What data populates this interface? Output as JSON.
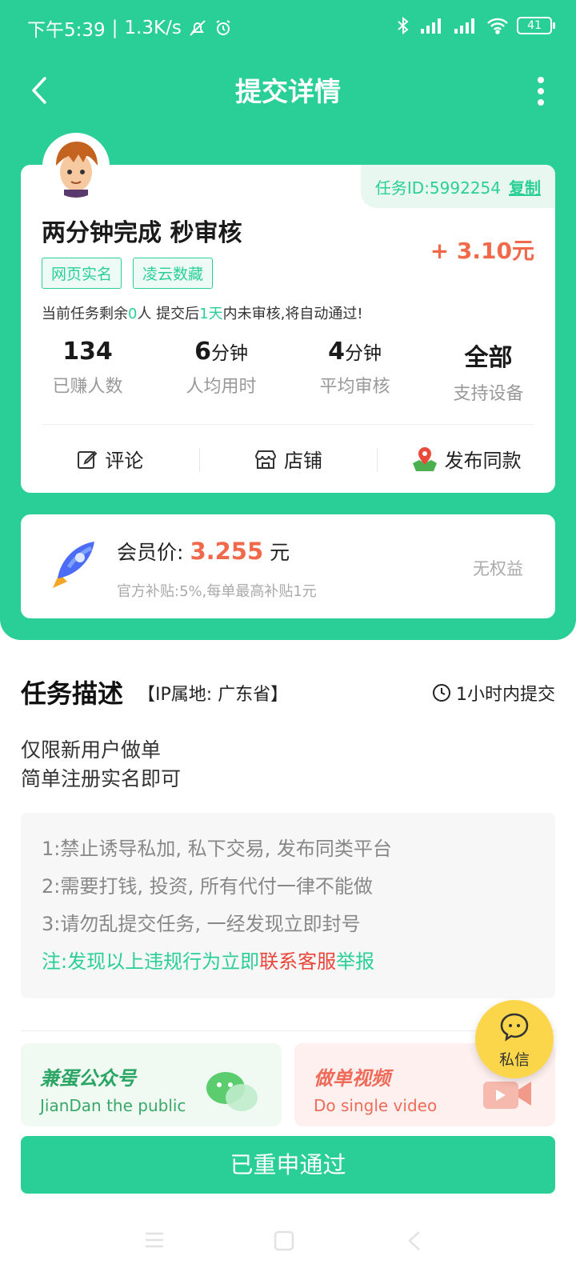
{
  "status_bar": {
    "time": "下午5:39",
    "speed": "1.3K/s",
    "battery": "41"
  },
  "header": {
    "title": "提交详情"
  },
  "task": {
    "id_label": "任务ID:5992254",
    "copy_label": "复制",
    "title": "两分钟完成 秒审核",
    "reward": "+ 3.10元",
    "tags": [
      "网页实名",
      "凌云数藏"
    ],
    "notice_prefix": "当前任务剩余",
    "notice_remaining": "0",
    "notice_mid": "人  提交后",
    "notice_days": "1天",
    "notice_suffix": "内未审核,将自动通过!",
    "stats": [
      {
        "value": "134",
        "unit": "",
        "label": "已赚人数"
      },
      {
        "value": "6",
        "unit": "分钟",
        "label": "人均用时"
      },
      {
        "value": "4",
        "unit": "分钟",
        "label": "平均审核"
      },
      {
        "value": "全部",
        "unit": "",
        "label": "支持设备"
      }
    ],
    "actions": {
      "comment": "评论",
      "shop": "店铺",
      "publish_same": "发布同款"
    }
  },
  "member": {
    "label": "会员价:",
    "price": "3.255",
    "unit": "元",
    "subsidy": "官方补贴:5%,每单最高补贴1元",
    "rights": "无权益"
  },
  "description": {
    "title": "任务描述",
    "ip_location": "【IP属地: 广东省】",
    "deadline": "1小时内提交",
    "lines": [
      "仅限新用户做单",
      "简单注册实名即可"
    ],
    "rules": [
      "1:禁止诱导私加, 私下交易, 发布同类平台",
      "2:需要打钱, 投资, 所有代付一律不能做",
      "3:请勿乱提交任务, 一经发现立即封号"
    ],
    "rule_note_a": "注:发现以上违规行为立即",
    "rule_note_b": "联系客服",
    "rule_note_c": "举报"
  },
  "promos": {
    "wechat_title": "兼蛋公众号",
    "wechat_sub": "JianDan the public",
    "video_title": "做单视频",
    "video_sub": "Do single video"
  },
  "chat": {
    "label": "私信"
  },
  "submit": {
    "label": "已重申通过"
  },
  "colors": {
    "brand": "#2acf97",
    "price": "#f0694a",
    "chat_fab": "#fcd64a"
  }
}
